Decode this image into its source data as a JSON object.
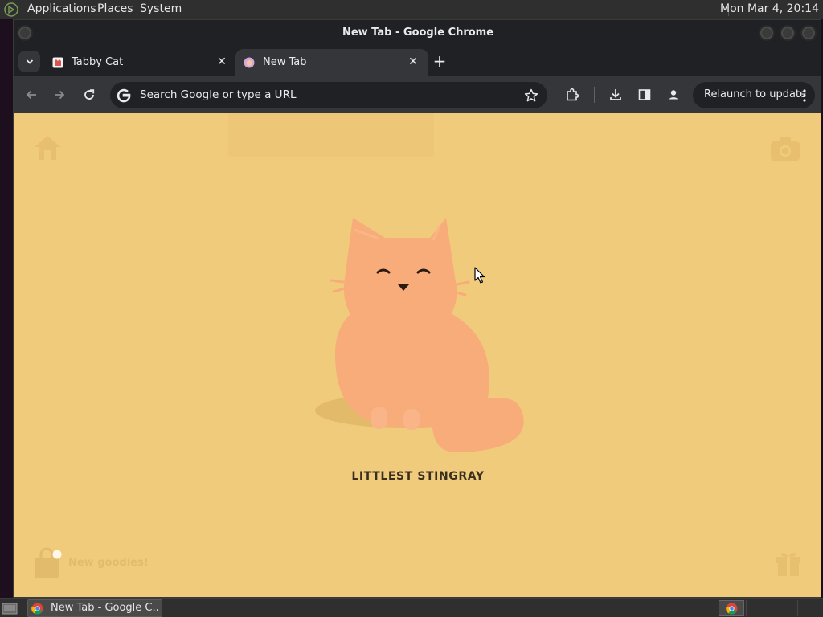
{
  "top_panel": {
    "menus": [
      "Applications",
      "Places",
      "System"
    ],
    "clock": "Mon Mar  4, 20:14"
  },
  "window": {
    "title": "New Tab - Google Chrome"
  },
  "tabs": [
    {
      "label": "Tabby Cat",
      "active": false
    },
    {
      "label": "New Tab",
      "active": true
    }
  ],
  "toolbar": {
    "omnibox_placeholder": "Search Google or type a URL",
    "relaunch_label": "Relaunch to update"
  },
  "content": {
    "cat_name": "LITTLEST STINGRAY",
    "goodies_label": "New goodies!",
    "background_color": "#f0cb7c",
    "cat_color": "#f8ac7a"
  },
  "taskbar": {
    "task_label": "New Tab - Google C..."
  }
}
